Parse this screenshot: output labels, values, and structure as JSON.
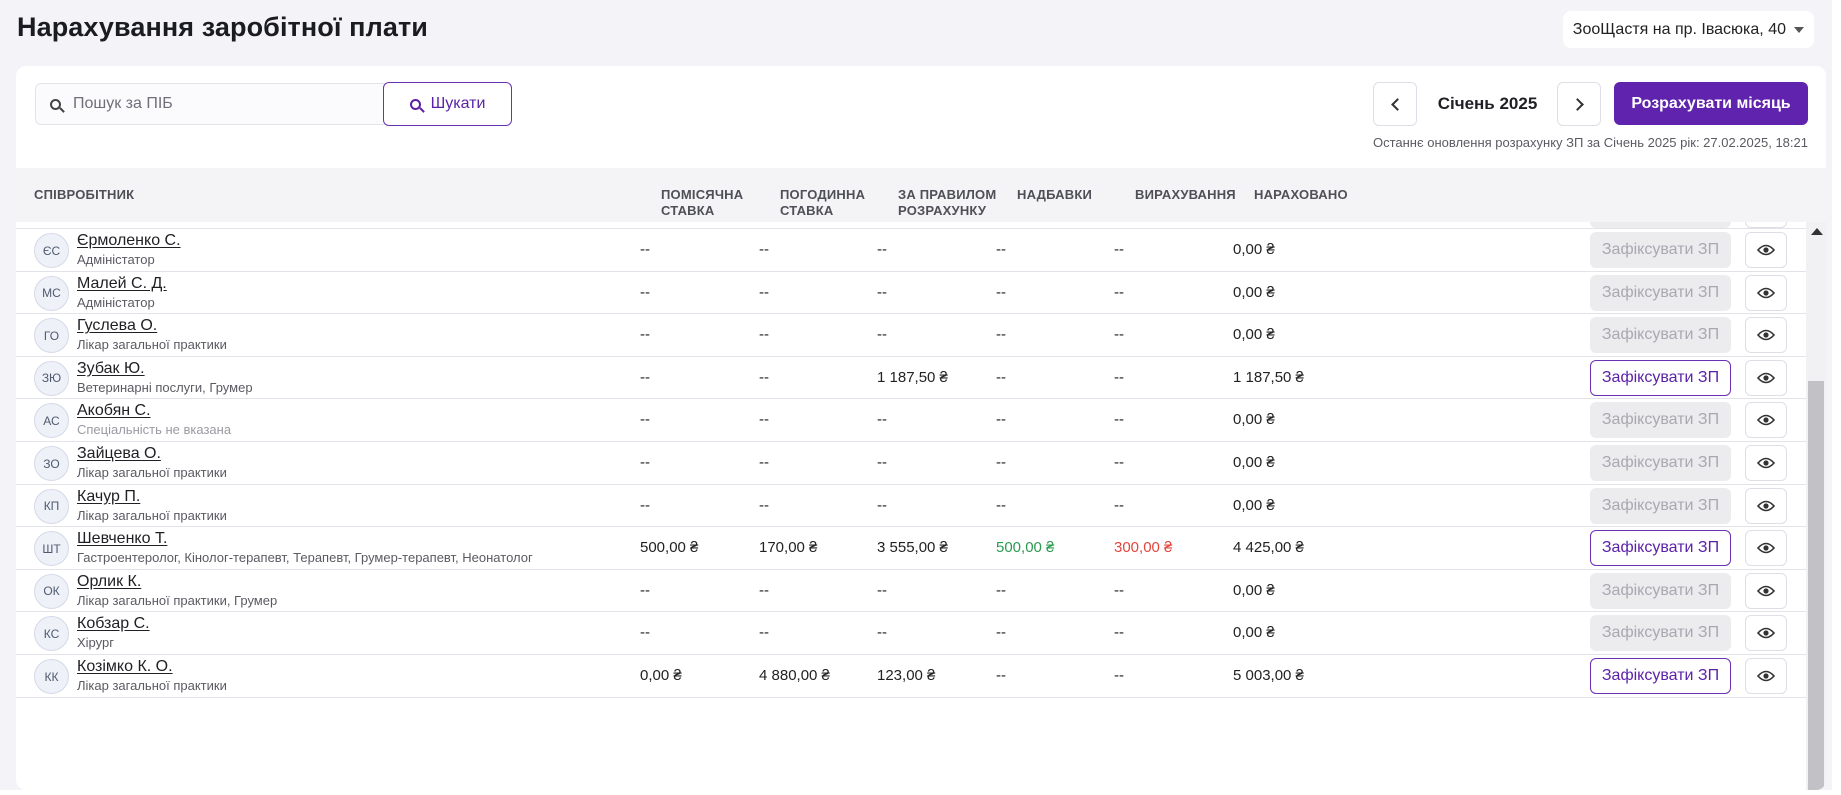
{
  "page": {
    "title": "Нарахування заробітної плати"
  },
  "clinic": {
    "selected": "ЗооЩастя на пр. Івасюка, 40"
  },
  "search": {
    "placeholder": "Пошук за ПІБ",
    "button_label": "Шукати"
  },
  "period": {
    "month_label": "Січень 2025",
    "calc_button_label": "Розрахувати місяць"
  },
  "last_update": "Останнє оновлення розрахунку ЗП за Січень 2025 рік: 27.02.2025, 18:21",
  "annotation": {
    "arrow_color": "#e31d1d"
  },
  "colors": {
    "accent": "#5f23ad",
    "positive": "#2d9a52",
    "negative": "#e2463f"
  },
  "table": {
    "headers": {
      "employee": "СПІВРОБІТНИК",
      "monthly_1": "ПОМІСЯЧНА",
      "monthly_2": "СТАВКА",
      "hourly_1": "ПОГОДИННА",
      "hourly_2": "СТАВКА",
      "rule_1": "ЗА ПРАВИЛОМ",
      "rule_2": "РОЗРАХУНКУ",
      "bonuses": "НАДБАВКИ",
      "deductions": "ВИРАХУВАННЯ",
      "accrued": "НАРАХОВАНО"
    },
    "fix_label": "Зафіксувати ЗП",
    "rows": [
      {
        "initials": "ЄС",
        "name": "Єрмоленко С.",
        "spec": "Адміністатор",
        "monthly": "--",
        "hourly": "--",
        "rule": "--",
        "bonus": "--",
        "deduct": "--",
        "accrued": "0,00 ₴",
        "fix_enabled": false
      },
      {
        "initials": "МС",
        "name": "Малей С. Д.",
        "spec": "Адміністатор",
        "monthly": "--",
        "hourly": "--",
        "rule": "--",
        "bonus": "--",
        "deduct": "--",
        "accrued": "0,00 ₴",
        "fix_enabled": false
      },
      {
        "initials": "ГО",
        "name": "Гуслева О.",
        "spec": "Лікар загальної практики",
        "monthly": "--",
        "hourly": "--",
        "rule": "--",
        "bonus": "--",
        "deduct": "--",
        "accrued": "0,00 ₴",
        "fix_enabled": false
      },
      {
        "initials": "ЗЮ",
        "name": "Зубак Ю.",
        "spec": "Ветеринарні послуги, Грумер",
        "monthly": "--",
        "hourly": "--",
        "rule": "1 187,50 ₴",
        "bonus": "--",
        "deduct": "--",
        "accrued": "1 187,50 ₴",
        "fix_enabled": true
      },
      {
        "initials": "АС",
        "name": "Акобян С.",
        "spec": "Спеціальність не вказана",
        "spec_muted": true,
        "monthly": "--",
        "hourly": "--",
        "rule": "--",
        "bonus": "--",
        "deduct": "--",
        "accrued": "0,00 ₴",
        "fix_enabled": false
      },
      {
        "initials": "ЗО",
        "name": "Зайцева О.",
        "spec": "Лікар загальної практики",
        "monthly": "--",
        "hourly": "--",
        "rule": "--",
        "bonus": "--",
        "deduct": "--",
        "accrued": "0,00 ₴",
        "fix_enabled": false
      },
      {
        "initials": "КП",
        "name": "Качур П.",
        "spec": "Лікар загальної практики",
        "monthly": "--",
        "hourly": "--",
        "rule": "--",
        "bonus": "--",
        "deduct": "--",
        "accrued": "0,00 ₴",
        "fix_enabled": false
      },
      {
        "initials": "ШТ",
        "name": "Шевченко Т.",
        "spec": "Гастроентеролог, Кінолог-терапевт, Терапевт, Грумер-терапевт, Неонатолог",
        "monthly": "500,00 ₴",
        "hourly": "170,00 ₴",
        "rule": "3 555,00 ₴",
        "bonus": "500,00 ₴",
        "bonus_color": "green",
        "deduct": "300,00 ₴",
        "deduct_color": "red",
        "accrued": "4 425,00 ₴",
        "fix_enabled": true
      },
      {
        "initials": "ОК",
        "name": "Орлик К.",
        "spec": "Лікар загальної практики, Грумер",
        "monthly": "--",
        "hourly": "--",
        "rule": "--",
        "bonus": "--",
        "deduct": "--",
        "accrued": "0,00 ₴",
        "fix_enabled": false
      },
      {
        "initials": "КС",
        "name": "Кобзар С.",
        "spec": "Хірург",
        "monthly": "--",
        "hourly": "--",
        "rule": "--",
        "bonus": "--",
        "deduct": "--",
        "accrued": "0,00 ₴",
        "fix_enabled": false
      },
      {
        "initials": "КК",
        "name": "Козімко К. О.",
        "spec": "Лікар загальної практики",
        "monthly": "0,00 ₴",
        "hourly": "4 880,00 ₴",
        "rule": "123,00 ₴",
        "bonus": "--",
        "deduct": "--",
        "accrued": "5 003,00 ₴",
        "fix_enabled": true
      }
    ]
  }
}
